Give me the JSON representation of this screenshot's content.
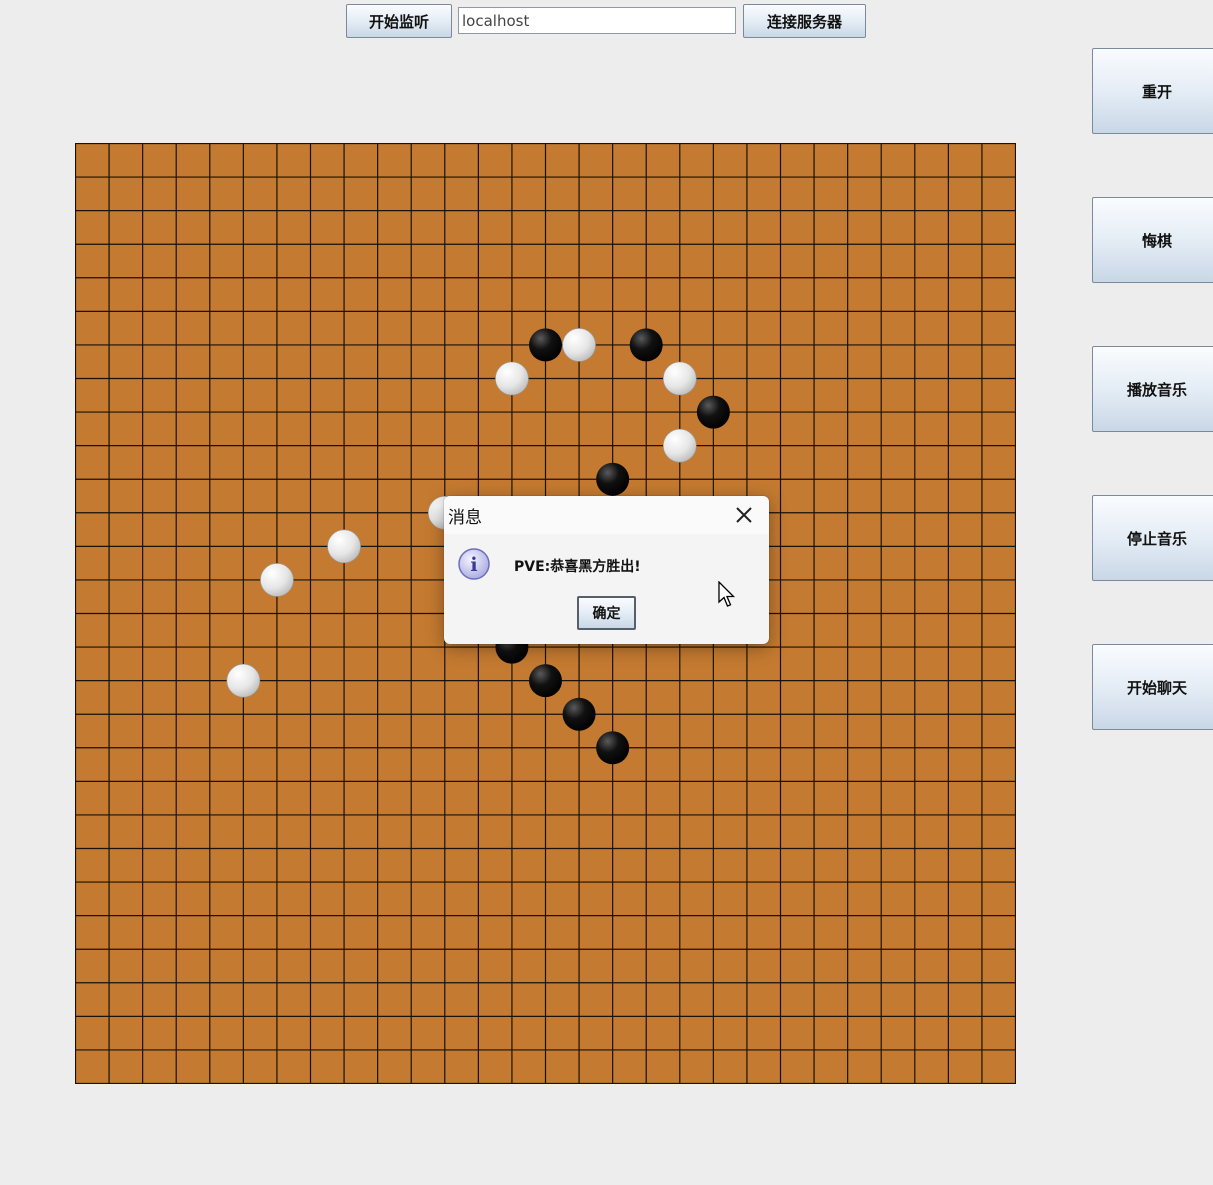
{
  "toolbar": {
    "listen_label": "开始监听",
    "host_value": "localhost",
    "connect_label": "连接服务器"
  },
  "sidebar": {
    "restart_label": "重开",
    "undo_label": "悔棋",
    "play_music_label": "播放音乐",
    "stop_music_label": "停止音乐",
    "chat_label": "开始聊天"
  },
  "board": {
    "grid_lines": 29,
    "board_color": "#c47a30",
    "line_color": "#1a1208",
    "stones": [
      {
        "color": "black",
        "col": 14,
        "row": 6
      },
      {
        "color": "white",
        "col": 15,
        "row": 6
      },
      {
        "color": "black",
        "col": 17,
        "row": 6
      },
      {
        "color": "white",
        "col": 13,
        "row": 7
      },
      {
        "color": "white",
        "col": 18,
        "row": 7
      },
      {
        "color": "black",
        "col": 19,
        "row": 8
      },
      {
        "color": "white",
        "col": 18,
        "row": 9
      },
      {
        "color": "black",
        "col": 16,
        "row": 10
      },
      {
        "color": "white",
        "col": 11,
        "row": 11
      },
      {
        "color": "white",
        "col": 8,
        "row": 12
      },
      {
        "color": "white",
        "col": 6,
        "row": 13
      },
      {
        "color": "white",
        "col": 5,
        "row": 16
      },
      {
        "color": "black",
        "col": 13,
        "row": 15
      },
      {
        "color": "black",
        "col": 14,
        "row": 16
      },
      {
        "color": "black",
        "col": 15,
        "row": 17
      },
      {
        "color": "black",
        "col": 16,
        "row": 18
      }
    ]
  },
  "dialog": {
    "title": "消息",
    "message": "PVE:恭喜黑方胜出!",
    "ok_label": "确定",
    "icon": "info-icon"
  }
}
